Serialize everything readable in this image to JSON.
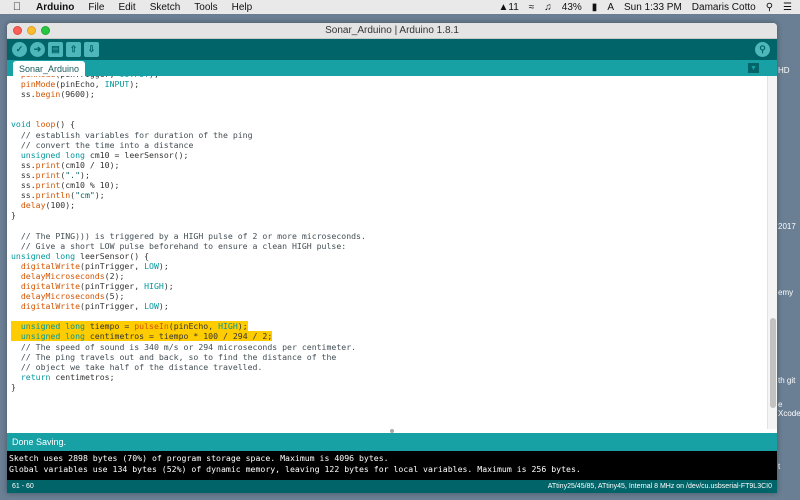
{
  "menubar": {
    "apple": "",
    "app": "Arduino",
    "items": [
      "File",
      "Edit",
      "Sketch",
      "Tools",
      "Help"
    ],
    "adobe": "11",
    "battery": "43%",
    "input": "A",
    "clock": "Sun 1:33 PM",
    "user": "Damaris Cotto"
  },
  "window": {
    "title": "Sonar_Arduino | Arduino 1.8.1",
    "tab": "Sonar_Arduino",
    "status": "Done Saving.",
    "footer_line": "61 - 60",
    "footer_board": "ATtiny25/45/85, ATtiny45, Internal 8 MHz on /dev/cu.usbserial-FT9L3CI0"
  },
  "toolbar": {
    "verify": "verify-icon",
    "upload": "upload-icon",
    "new": "new-icon",
    "open": "open-icon",
    "save": "save-icon",
    "serial": "serial-monitor-icon"
  },
  "code_lines": [
    "  pinMode(pinTrigger, OUTPUT);",
    "  pinMode(pinEcho, INPUT);",
    "  ss.begin(9600);",
    "",
    "",
    "void loop() {",
    "  // establish variables for duration of the ping",
    "  // convert the time into a distance",
    "  unsigned long cm10 = leerSensor();",
    "  ss.print(cm10 / 10);",
    "  ss.print(\".\");",
    "  ss.print(cm10 % 10);",
    "  ss.println(\"cm\");",
    "  delay(100);",
    "}",
    "",
    "  // The PING))) is triggered by a HIGH pulse of 2 or more microseconds.",
    "  // Give a short LOW pulse beforehand to ensure a clean HIGH pulse:",
    "unsigned long leerSensor() {",
    "  digitalWrite(pinTrigger, LOW);",
    "  delayMicroseconds(2);",
    "  digitalWrite(pinTrigger, HIGH);",
    "  delayMicroseconds(5);",
    "  digitalWrite(pinTrigger, LOW);",
    "",
    "  unsigned long tiempo = pulseIn(pinEcho, HIGH);",
    "  unsigned long centimetros = tiempo * 100 / 294 / 2;",
    "  // The speed of sound is 340 m/s or 294 microseconds per centimeter.",
    "  // The ping travels out and back, so to find the distance of the",
    "  // object we take half of the distance travelled.",
    "  return centimetros;",
    "}"
  ],
  "highlighted_lines": [
    25,
    26
  ],
  "console_lines": [
    "Sketch uses 2898 bytes (70%) of program storage space. Maximum is 4096 bytes.",
    "Global variables use 134 bytes (52%) of dynamic memory, leaving 122 bytes for local variables. Maximum is 256 bytes."
  ],
  "desktop_labels": [
    "HD",
    "2017",
    "emy",
    "th git",
    "e Xcode",
    "t"
  ],
  "colors": {
    "teal_dark": "#006468",
    "teal_light": "#17a1a5",
    "highlight": "#ffcc00"
  }
}
